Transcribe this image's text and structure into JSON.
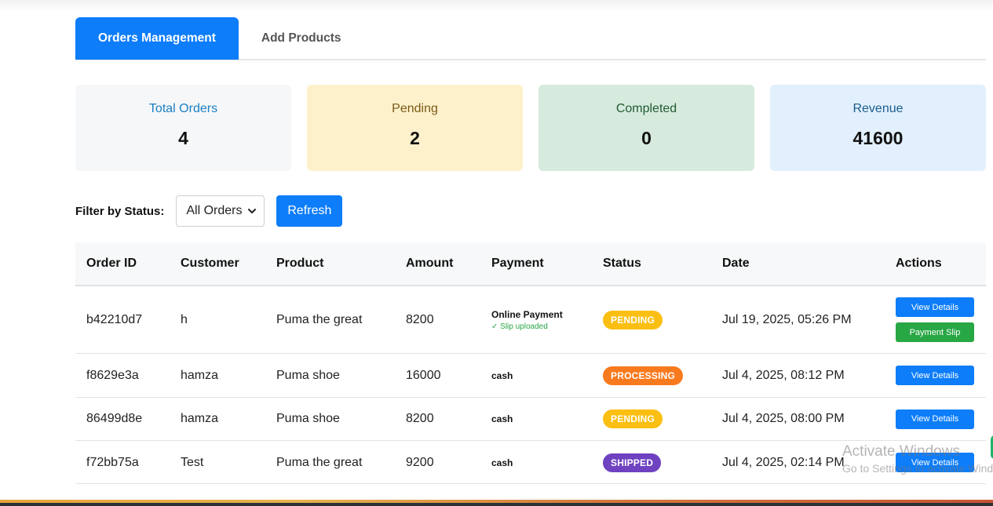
{
  "tabs": [
    {
      "label": "Orders Management",
      "active": true
    },
    {
      "label": "Add Products",
      "active": false
    }
  ],
  "stats": {
    "total_orders": {
      "label": "Total Orders",
      "value": "4"
    },
    "pending": {
      "label": "Pending",
      "value": "2"
    },
    "completed": {
      "label": "Completed",
      "value": "0"
    },
    "revenue": {
      "label": "Revenue",
      "value": "41600"
    }
  },
  "filter": {
    "label": "Filter by Status:",
    "selected": "All Orders",
    "refresh_label": "Refresh"
  },
  "table": {
    "headers": [
      "Order ID",
      "Customer",
      "Product",
      "Amount",
      "Payment",
      "Status",
      "Date",
      "Actions"
    ],
    "rows": [
      {
        "order_id": "b42210d7",
        "customer": "h",
        "product": "Puma the great",
        "amount": "8200",
        "payment": "Online Payment",
        "payment_note": "✓ Slip uploaded",
        "status": "PENDING",
        "date": "Jul 19, 2025, 05:26 PM",
        "view_label": "View Details",
        "slip_label": "Payment Slip"
      },
      {
        "order_id": "f8629e3a",
        "customer": "hamza",
        "product": "Puma shoe",
        "amount": "16000",
        "payment": "cash",
        "status": "PROCESSING",
        "date": "Jul 4, 2025, 08:12 PM",
        "view_label": "View Details"
      },
      {
        "order_id": "86499d8e",
        "customer": "hamza",
        "product": "Puma shoe",
        "amount": "8200",
        "payment": "cash",
        "status": "PENDING",
        "date": "Jul 4, 2025, 08:00 PM",
        "view_label": "View Details"
      },
      {
        "order_id": "f72bb75a",
        "customer": "Test",
        "product": "Puma the great",
        "amount": "9200",
        "payment": "cash",
        "status": "SHIPPED",
        "date": "Jul 4, 2025, 02:14 PM",
        "view_label": "View Details"
      }
    ]
  },
  "watermark": {
    "line1": "Activate Windows",
    "line2": "Go to Settings to activate Windows."
  },
  "colors": {
    "accent": "#0d7df9",
    "pending_badge": "#fbbf12",
    "processing_badge": "#f97a1e",
    "shipped_badge": "#6f42c1",
    "slip_button": "#28a745"
  }
}
